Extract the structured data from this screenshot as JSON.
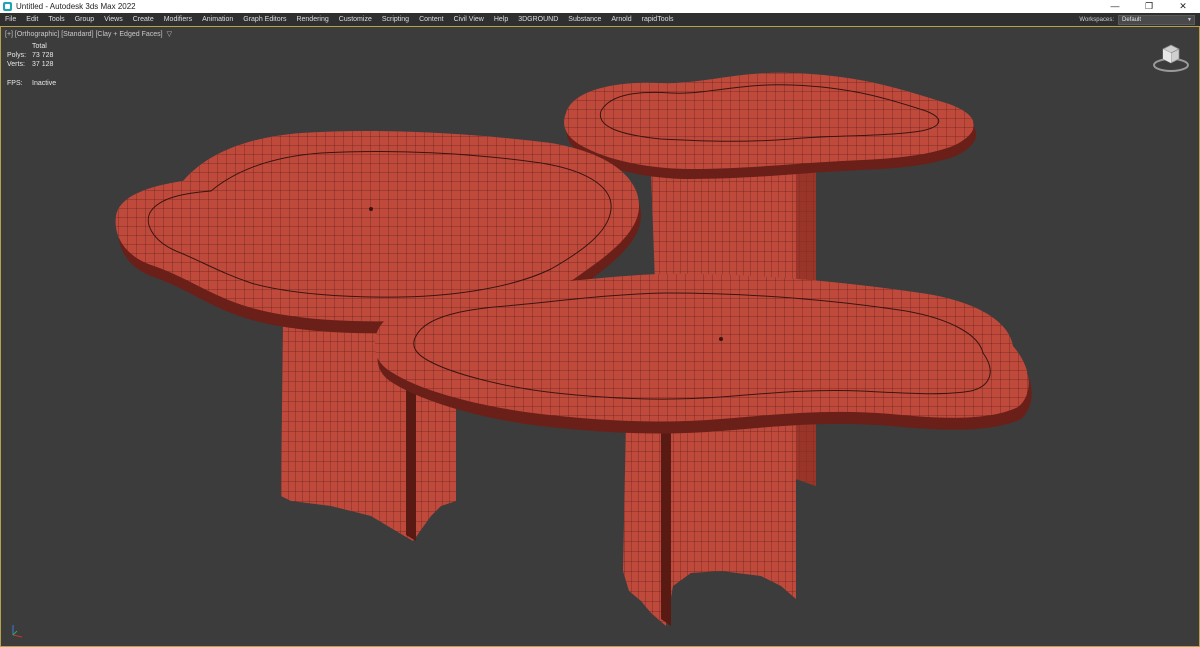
{
  "titlebar": {
    "title": "Untitled - Autodesk 3ds Max 2022",
    "minimize": "—",
    "restore": "❐",
    "close": "✕"
  },
  "menubar": {
    "items": [
      "File",
      "Edit",
      "Tools",
      "Group",
      "Views",
      "Create",
      "Modifiers",
      "Animation",
      "Graph Editors",
      "Rendering",
      "Customize",
      "Scripting",
      "Content",
      "Civil View",
      "Help",
      "3DGROUND",
      "Substance",
      "Arnold",
      "rapidTools"
    ],
    "workspace_label": "Workspaces:",
    "workspace_value": "Default"
  },
  "viewport": {
    "label": "[+] [Orthographic] [Standard] [Clay + Edged Faces]",
    "stats": {
      "total_label": "Total",
      "polys_label": "Polys:",
      "polys_value": "73 728",
      "verts_label": "Verts:",
      "verts_value": "37 128",
      "fps_label": "FPS:",
      "fps_value": "Inactive"
    }
  },
  "colors": {
    "clay": "#bf4a3c",
    "clay_dark": "#8a2c22",
    "wire": "#3a1410",
    "background": "#3c3c3c",
    "viewport_border": "#b8a14a"
  },
  "icons": {
    "app": "3ds-max-icon",
    "filter": "filter-icon",
    "viewcube": "viewcube-icon",
    "axis": "axis-tripod-icon"
  }
}
